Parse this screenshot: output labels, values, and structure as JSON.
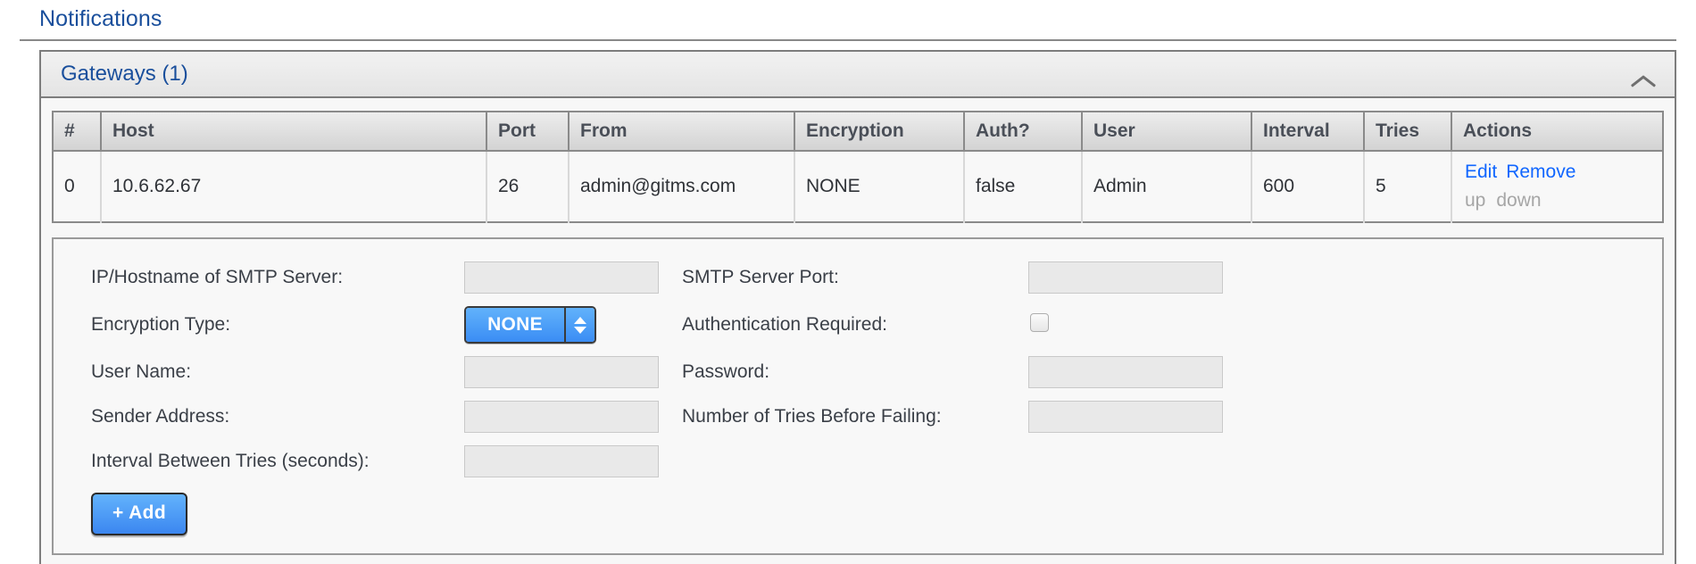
{
  "page": {
    "section_title": "Notifications",
    "accent_color": "#1a4f9c",
    "link_color": "#1066ff",
    "disabled_link_color": "#a6a6a6"
  },
  "panel": {
    "title": "Gateways (1)",
    "collapse_icon": "chevron-up-icon"
  },
  "table": {
    "columns": [
      "#",
      "Host",
      "Port",
      "From",
      "Encryption",
      "Auth?",
      "User",
      "Interval",
      "Tries",
      "Actions"
    ],
    "rows": [
      {
        "index": "0",
        "host": "10.6.62.67",
        "port": "26",
        "from": "admin@gitms.com",
        "encryption": "NONE",
        "auth": "false",
        "user": "Admin",
        "interval": "600",
        "tries": "5",
        "actions": {
          "edit": "Edit",
          "remove": "Remove",
          "up": "up",
          "down": "down"
        }
      }
    ]
  },
  "form": {
    "fields": {
      "smtp_host_label": "IP/Hostname of SMTP Server:",
      "smtp_host_value": "",
      "smtp_port_label": "SMTP Server Port:",
      "smtp_port_value": "",
      "encryption_label": "Encryption Type:",
      "encryption_value": "NONE",
      "encryption_options": [
        "NONE"
      ],
      "auth_required_label": "Authentication Required:",
      "auth_required_checked": "false",
      "user_name_label": "User Name:",
      "user_name_value": "",
      "password_label": "Password:",
      "password_value": "",
      "sender_address_label": "Sender Address:",
      "sender_address_value": "",
      "tries_label": "Number of Tries Before Failing:",
      "tries_value": "",
      "interval_label": "Interval Between Tries (seconds):",
      "interval_value": ""
    },
    "add_button_label": "+ Add"
  }
}
